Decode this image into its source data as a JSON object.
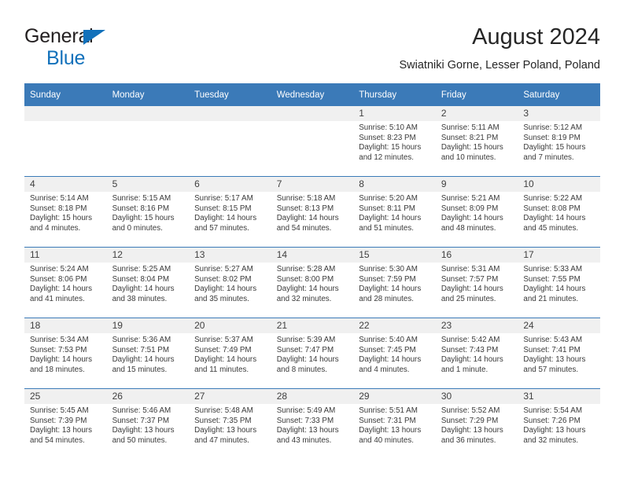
{
  "brand": {
    "name_part1": "General",
    "name_part2": "Blue",
    "colors": {
      "blue": "#1271bb",
      "dark": "#231f20"
    }
  },
  "header": {
    "title": "August 2024",
    "subtitle": "Swiatniki Gorne, Lesser Poland, Poland"
  },
  "theme": {
    "header_blue": "#3b7ab8",
    "daynum_background": "#f0f0f0",
    "row_divider": "#3b7ab8"
  },
  "weekdays": [
    "Sunday",
    "Monday",
    "Tuesday",
    "Wednesday",
    "Thursday",
    "Friday",
    "Saturday"
  ],
  "weeks": [
    [
      {
        "day": "",
        "empty": true,
        "sunrise": "",
        "sunset": "",
        "daylight1": "",
        "daylight2": ""
      },
      {
        "day": "",
        "empty": true,
        "sunrise": "",
        "sunset": "",
        "daylight1": "",
        "daylight2": ""
      },
      {
        "day": "",
        "empty": true,
        "sunrise": "",
        "sunset": "",
        "daylight1": "",
        "daylight2": ""
      },
      {
        "day": "",
        "empty": true,
        "sunrise": "",
        "sunset": "",
        "daylight1": "",
        "daylight2": ""
      },
      {
        "day": "1",
        "sunrise": "Sunrise: 5:10 AM",
        "sunset": "Sunset: 8:23 PM",
        "daylight1": "Daylight: 15 hours",
        "daylight2": "and 12 minutes."
      },
      {
        "day": "2",
        "sunrise": "Sunrise: 5:11 AM",
        "sunset": "Sunset: 8:21 PM",
        "daylight1": "Daylight: 15 hours",
        "daylight2": "and 10 minutes."
      },
      {
        "day": "3",
        "sunrise": "Sunrise: 5:12 AM",
        "sunset": "Sunset: 8:19 PM",
        "daylight1": "Daylight: 15 hours",
        "daylight2": "and 7 minutes."
      }
    ],
    [
      {
        "day": "4",
        "sunrise": "Sunrise: 5:14 AM",
        "sunset": "Sunset: 8:18 PM",
        "daylight1": "Daylight: 15 hours",
        "daylight2": "and 4 minutes."
      },
      {
        "day": "5",
        "sunrise": "Sunrise: 5:15 AM",
        "sunset": "Sunset: 8:16 PM",
        "daylight1": "Daylight: 15 hours",
        "daylight2": "and 0 minutes."
      },
      {
        "day": "6",
        "sunrise": "Sunrise: 5:17 AM",
        "sunset": "Sunset: 8:15 PM",
        "daylight1": "Daylight: 14 hours",
        "daylight2": "and 57 minutes."
      },
      {
        "day": "7",
        "sunrise": "Sunrise: 5:18 AM",
        "sunset": "Sunset: 8:13 PM",
        "daylight1": "Daylight: 14 hours",
        "daylight2": "and 54 minutes."
      },
      {
        "day": "8",
        "sunrise": "Sunrise: 5:20 AM",
        "sunset": "Sunset: 8:11 PM",
        "daylight1": "Daylight: 14 hours",
        "daylight2": "and 51 minutes."
      },
      {
        "day": "9",
        "sunrise": "Sunrise: 5:21 AM",
        "sunset": "Sunset: 8:09 PM",
        "daylight1": "Daylight: 14 hours",
        "daylight2": "and 48 minutes."
      },
      {
        "day": "10",
        "sunrise": "Sunrise: 5:22 AM",
        "sunset": "Sunset: 8:08 PM",
        "daylight1": "Daylight: 14 hours",
        "daylight2": "and 45 minutes."
      }
    ],
    [
      {
        "day": "11",
        "sunrise": "Sunrise: 5:24 AM",
        "sunset": "Sunset: 8:06 PM",
        "daylight1": "Daylight: 14 hours",
        "daylight2": "and 41 minutes."
      },
      {
        "day": "12",
        "sunrise": "Sunrise: 5:25 AM",
        "sunset": "Sunset: 8:04 PM",
        "daylight1": "Daylight: 14 hours",
        "daylight2": "and 38 minutes."
      },
      {
        "day": "13",
        "sunrise": "Sunrise: 5:27 AM",
        "sunset": "Sunset: 8:02 PM",
        "daylight1": "Daylight: 14 hours",
        "daylight2": "and 35 minutes."
      },
      {
        "day": "14",
        "sunrise": "Sunrise: 5:28 AM",
        "sunset": "Sunset: 8:00 PM",
        "daylight1": "Daylight: 14 hours",
        "daylight2": "and 32 minutes."
      },
      {
        "day": "15",
        "sunrise": "Sunrise: 5:30 AM",
        "sunset": "Sunset: 7:59 PM",
        "daylight1": "Daylight: 14 hours",
        "daylight2": "and 28 minutes."
      },
      {
        "day": "16",
        "sunrise": "Sunrise: 5:31 AM",
        "sunset": "Sunset: 7:57 PM",
        "daylight1": "Daylight: 14 hours",
        "daylight2": "and 25 minutes."
      },
      {
        "day": "17",
        "sunrise": "Sunrise: 5:33 AM",
        "sunset": "Sunset: 7:55 PM",
        "daylight1": "Daylight: 14 hours",
        "daylight2": "and 21 minutes."
      }
    ],
    [
      {
        "day": "18",
        "sunrise": "Sunrise: 5:34 AM",
        "sunset": "Sunset: 7:53 PM",
        "daylight1": "Daylight: 14 hours",
        "daylight2": "and 18 minutes."
      },
      {
        "day": "19",
        "sunrise": "Sunrise: 5:36 AM",
        "sunset": "Sunset: 7:51 PM",
        "daylight1": "Daylight: 14 hours",
        "daylight2": "and 15 minutes."
      },
      {
        "day": "20",
        "sunrise": "Sunrise: 5:37 AM",
        "sunset": "Sunset: 7:49 PM",
        "daylight1": "Daylight: 14 hours",
        "daylight2": "and 11 minutes."
      },
      {
        "day": "21",
        "sunrise": "Sunrise: 5:39 AM",
        "sunset": "Sunset: 7:47 PM",
        "daylight1": "Daylight: 14 hours",
        "daylight2": "and 8 minutes."
      },
      {
        "day": "22",
        "sunrise": "Sunrise: 5:40 AM",
        "sunset": "Sunset: 7:45 PM",
        "daylight1": "Daylight: 14 hours",
        "daylight2": "and 4 minutes."
      },
      {
        "day": "23",
        "sunrise": "Sunrise: 5:42 AM",
        "sunset": "Sunset: 7:43 PM",
        "daylight1": "Daylight: 14 hours",
        "daylight2": "and 1 minute."
      },
      {
        "day": "24",
        "sunrise": "Sunrise: 5:43 AM",
        "sunset": "Sunset: 7:41 PM",
        "daylight1": "Daylight: 13 hours",
        "daylight2": "and 57 minutes."
      }
    ],
    [
      {
        "day": "25",
        "sunrise": "Sunrise: 5:45 AM",
        "sunset": "Sunset: 7:39 PM",
        "daylight1": "Daylight: 13 hours",
        "daylight2": "and 54 minutes."
      },
      {
        "day": "26",
        "sunrise": "Sunrise: 5:46 AM",
        "sunset": "Sunset: 7:37 PM",
        "daylight1": "Daylight: 13 hours",
        "daylight2": "and 50 minutes."
      },
      {
        "day": "27",
        "sunrise": "Sunrise: 5:48 AM",
        "sunset": "Sunset: 7:35 PM",
        "daylight1": "Daylight: 13 hours",
        "daylight2": "and 47 minutes."
      },
      {
        "day": "28",
        "sunrise": "Sunrise: 5:49 AM",
        "sunset": "Sunset: 7:33 PM",
        "daylight1": "Daylight: 13 hours",
        "daylight2": "and 43 minutes."
      },
      {
        "day": "29",
        "sunrise": "Sunrise: 5:51 AM",
        "sunset": "Sunset: 7:31 PM",
        "daylight1": "Daylight: 13 hours",
        "daylight2": "and 40 minutes."
      },
      {
        "day": "30",
        "sunrise": "Sunrise: 5:52 AM",
        "sunset": "Sunset: 7:29 PM",
        "daylight1": "Daylight: 13 hours",
        "daylight2": "and 36 minutes."
      },
      {
        "day": "31",
        "sunrise": "Sunrise: 5:54 AM",
        "sunset": "Sunset: 7:26 PM",
        "daylight1": "Daylight: 13 hours",
        "daylight2": "and 32 minutes."
      }
    ]
  ]
}
